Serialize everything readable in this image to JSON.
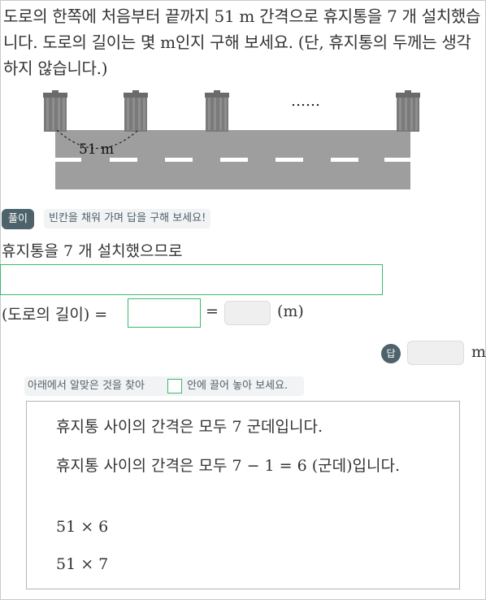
{
  "problem": {
    "text": "도로의 한쪽에 처음부터 끝까지 51 m 간격으로 휴지통을 7 개 설치했습니다. 도로의 길이는 몇 m인지 구해 보세요. (단, 휴지통의 두께는 생각하지 않습니다.)"
  },
  "figure": {
    "distance_label": "51 m",
    "ellipsis": "……",
    "colors": {
      "road": "#9e9e9e",
      "lane": "#ffffff",
      "can": "#7a7a7a"
    }
  },
  "solution": {
    "badge": "풀이",
    "hint": "빈칸을 채워 가며 답을 구해 보세요!",
    "step1": "휴지통을 7 개 설치했으므로",
    "equation_lhs": "(도로의 길이) =",
    "equals": "=",
    "unit_paren": "(m)"
  },
  "answer": {
    "badge": "답",
    "unit": "m"
  },
  "drag": {
    "instruction_before": "아래에서 알맞은 것을 찾아",
    "instruction_after": "안에 끌어 놓아 보세요.",
    "options": [
      "휴지통 사이의 간격은 모두 7 군데입니다.",
      "휴지통 사이의 간격은 모두 7 − 1 = 6 (군데)입니다.",
      "51 × 6",
      "51 × 7"
    ]
  },
  "accent_color": "#3cb96a",
  "badge_color": "#4e626b"
}
